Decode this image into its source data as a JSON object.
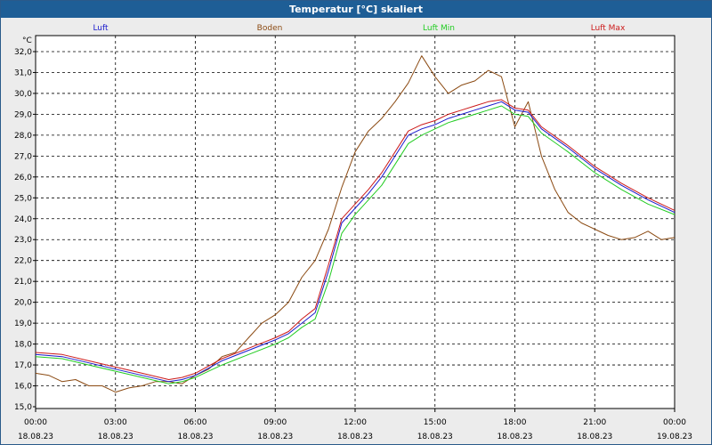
{
  "window": {
    "title": "Temperatur [°C] skaliert"
  },
  "chart_data": {
    "type": "line",
    "title": "Temperatur [°C] skaliert",
    "ylabel": "°C",
    "xlabel": "",
    "ylim": [
      15.0,
      32.0
    ],
    "y_ticks": [
      "15,0",
      "16,0",
      "17,0",
      "18,0",
      "19,0",
      "20,0",
      "21,0",
      "22,0",
      "23,0",
      "24,0",
      "25,0",
      "26,0",
      "27,0",
      "28,0",
      "29,0",
      "30,0",
      "31,0",
      "32,0"
    ],
    "x_ticks": [
      {
        "time": "00:00",
        "date": "18.08.23"
      },
      {
        "time": "03:00",
        "date": "18.08.23"
      },
      {
        "time": "06:00",
        "date": "18.08.23"
      },
      {
        "time": "09:00",
        "date": "18.08.23"
      },
      {
        "time": "12:00",
        "date": "18.08.23"
      },
      {
        "time": "15:00",
        "date": "18.08.23"
      },
      {
        "time": "18:00",
        "date": "18.08.23"
      },
      {
        "time": "21:00",
        "date": "18.08.23"
      },
      {
        "time": "00:00",
        "date": "19.08.23"
      }
    ],
    "x_unit": "hours",
    "grid": true,
    "legend_placement": "top",
    "series": [
      {
        "name": "Luft",
        "color": "#1a1acc",
        "x": [
          0,
          1,
          2,
          3,
          4,
          5,
          5.5,
          6,
          7,
          8,
          9,
          9.5,
          10,
          10.5,
          11,
          11.5,
          12,
          12.5,
          13,
          13.5,
          14,
          14.5,
          15,
          15.5,
          16,
          16.5,
          17,
          17.5,
          18,
          18.5,
          19,
          20,
          21,
          22,
          23,
          24
        ],
        "y": [
          17.5,
          17.4,
          17.1,
          16.8,
          16.5,
          16.2,
          16.3,
          16.5,
          17.2,
          17.7,
          18.2,
          18.5,
          19.0,
          19.5,
          21.5,
          23.8,
          24.5,
          25.2,
          26.0,
          27.0,
          28.0,
          28.3,
          28.5,
          28.8,
          29.0,
          29.2,
          29.4,
          29.6,
          29.2,
          29.1,
          28.3,
          27.4,
          26.4,
          25.6,
          24.9,
          24.3
        ]
      },
      {
        "name": "Boden",
        "color": "#8b4a12",
        "x": [
          0,
          0.5,
          1,
          1.5,
          2,
          2.5,
          3,
          3.5,
          4,
          4.5,
          5,
          5.5,
          6,
          6.5,
          7,
          7.5,
          8,
          8.5,
          9,
          9.5,
          10,
          10.5,
          11,
          11.5,
          12,
          12.5,
          13,
          13.5,
          14,
          14.5,
          15,
          15.5,
          16,
          16.5,
          17,
          17.5,
          18,
          18.5,
          19,
          19.5,
          20,
          20.5,
          21,
          21.5,
          22,
          22.5,
          23,
          23.5,
          24
        ],
        "y": [
          16.6,
          16.5,
          16.2,
          16.3,
          16.0,
          16.0,
          15.7,
          15.9,
          16.0,
          16.2,
          16.2,
          16.1,
          16.5,
          16.8,
          17.4,
          17.6,
          18.3,
          19.0,
          19.4,
          20.0,
          21.2,
          22.0,
          23.5,
          25.5,
          27.2,
          28.2,
          28.8,
          29.6,
          30.5,
          31.8,
          30.8,
          30.0,
          30.4,
          30.6,
          31.1,
          30.8,
          28.4,
          29.6,
          27.0,
          25.4,
          24.3,
          23.8,
          23.5,
          23.2,
          23.0,
          23.1,
          23.4,
          23.0,
          23.1
        ]
      },
      {
        "name": "Luft Min",
        "color": "#22cc22",
        "x": [
          0,
          1,
          2,
          3,
          4,
          5,
          5.5,
          6,
          7,
          8,
          9,
          9.5,
          10,
          10.5,
          11,
          11.5,
          12,
          12.5,
          13,
          13.5,
          14,
          14.5,
          15,
          15.5,
          16,
          16.5,
          17,
          17.5,
          18,
          18.5,
          19,
          20,
          21,
          22,
          23,
          24
        ],
        "y": [
          17.4,
          17.3,
          17.0,
          16.7,
          16.4,
          16.1,
          16.2,
          16.4,
          17.0,
          17.5,
          18.0,
          18.3,
          18.8,
          19.2,
          21.0,
          23.3,
          24.2,
          24.9,
          25.6,
          26.6,
          27.6,
          28.0,
          28.3,
          28.6,
          28.8,
          29.0,
          29.2,
          29.4,
          29.0,
          28.9,
          28.1,
          27.2,
          26.2,
          25.4,
          24.7,
          24.2
        ]
      },
      {
        "name": "Luft Max",
        "color": "#cc1a1a",
        "x": [
          0,
          1,
          2,
          3,
          4,
          5,
          5.5,
          6,
          7,
          8,
          9,
          9.5,
          10,
          10.5,
          11,
          11.5,
          12,
          12.5,
          13,
          13.5,
          14,
          14.5,
          15,
          15.5,
          16,
          16.5,
          17,
          17.5,
          18,
          18.5,
          19,
          20,
          21,
          22,
          23,
          24
        ],
        "y": [
          17.6,
          17.5,
          17.2,
          16.9,
          16.6,
          16.3,
          16.4,
          16.6,
          17.3,
          17.8,
          18.3,
          18.6,
          19.2,
          19.7,
          21.8,
          24.0,
          24.7,
          25.4,
          26.2,
          27.2,
          28.2,
          28.5,
          28.7,
          29.0,
          29.2,
          29.4,
          29.6,
          29.7,
          29.3,
          29.2,
          28.4,
          27.5,
          26.5,
          25.7,
          25.0,
          24.4
        ]
      }
    ]
  }
}
